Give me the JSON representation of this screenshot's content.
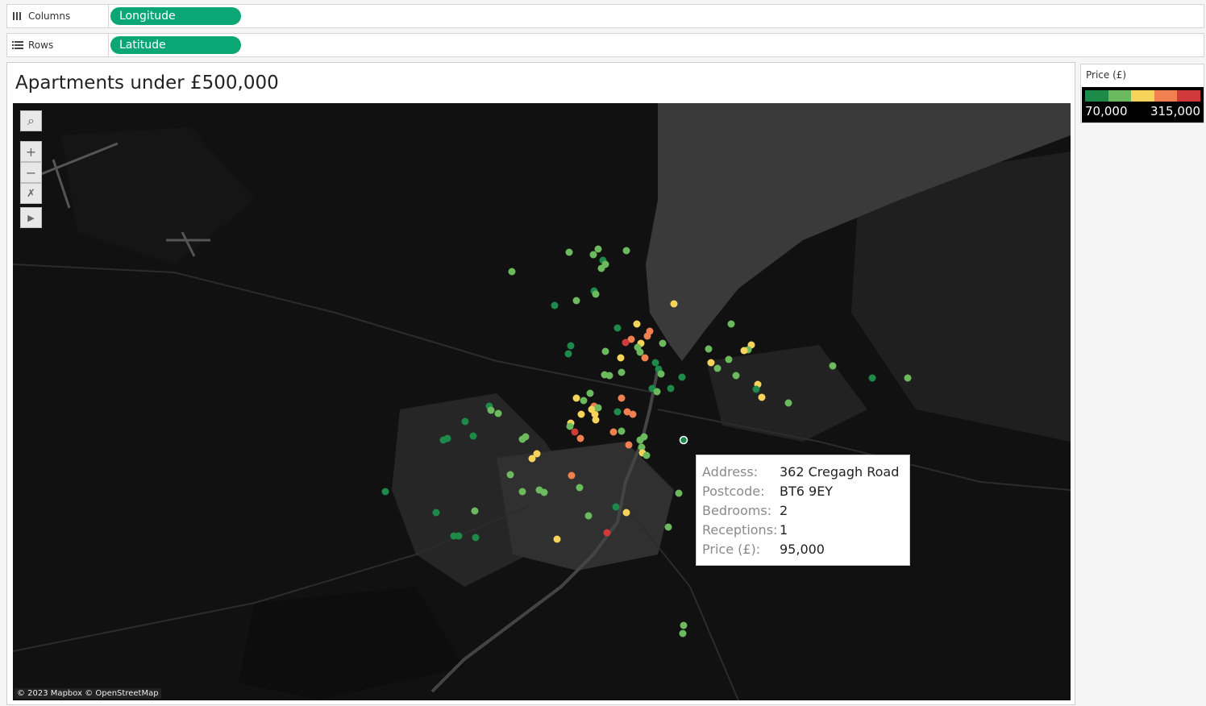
{
  "shelves": {
    "columns": {
      "label": "Columns",
      "pill": "Longitude"
    },
    "rows": {
      "label": "Rows",
      "pill": "Latitude"
    }
  },
  "sheet": {
    "title": "Apartments under £500,000"
  },
  "map": {
    "attribution": "© 2023 Mapbox © OpenStreetMap",
    "tools": [
      "search-icon",
      "zoom-in-icon",
      "zoom-out-icon",
      "pin-clear-icon",
      "expand-arrow-icon"
    ]
  },
  "tooltip": {
    "rows": [
      {
        "key": "Address:",
        "value": "362 Cregagh Road"
      },
      {
        "key": "Postcode:",
        "value": "BT6 9EY"
      },
      {
        "key": "Bedrooms:",
        "value": "2"
      },
      {
        "key": "Receptions:",
        "value": "1"
      },
      {
        "key": "Price (£):",
        "value": "95,000"
      }
    ]
  },
  "legend": {
    "title": "Price (£)",
    "min": "70,000",
    "max": "315,000",
    "colors": [
      "#1e8a4a",
      "#6cba5e",
      "#f6d45c",
      "#f08050",
      "#d13a3a"
    ]
  },
  "colors": {
    "pill": "#0aa774",
    "map_background": "#111111",
    "water": "#3a3a3a",
    "land": "#1a1a1a"
  }
}
